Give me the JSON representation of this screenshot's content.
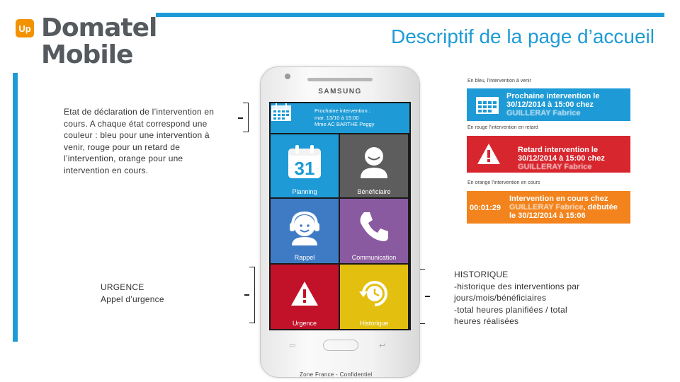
{
  "header": {
    "logo_badge": "Up",
    "logo_line1": "Domatel",
    "logo_line2": "Mobile",
    "title": "Descriptif de la page d’accueil"
  },
  "notes": {
    "status": "Etat de déclaration de l’intervention en cours. A chaque état correspond une couleur : bleu pour une intervention à venir, rouge pour un retard de l’intervention, orange pour une intervention en cours.",
    "urgence_line1": "URGENCE",
    "urgence_line2": "Appel d’urgence",
    "historique_line1": "HISTORIQUE",
    "historique_line2": "-historique des interventions par jours/mois/bénéficiaires",
    "historique_line3": "-total heures planifiées / total heures réalisées"
  },
  "phone": {
    "brand": "SAMSUNG",
    "banner_line1": "Prochaine intervention :",
    "banner_line2": "mar. 13/10 à 15:00",
    "banner_line3": "Mme AC BARTHE Peggy",
    "calendar_day": "31",
    "tiles": {
      "planning": "Planning",
      "beneficiaire": "Bénéficiaire",
      "rappel": "Rappel",
      "communication": "Communication",
      "urgence": "Urgence",
      "historique": "Historique"
    }
  },
  "states": {
    "blue_caption": "En bleu, l’intervention à venir",
    "blue_line1": "Prochaine intervention le",
    "blue_line2": "30/12/2014 à 15:00 chez",
    "blue_line3": "GUILLERAY Fabrice",
    "red_caption": "En rouge l’intervention en retard",
    "red_line1": "Retard intervention le",
    "red_line2": "30/12/2014 à 15:00 chez",
    "red_line3": "GUILLERAY Fabrice",
    "orange_caption": "En orange l’intervention en cours",
    "orange_timer": "00:01:29",
    "orange_line1": "Intervention en cours chez",
    "orange_line2_name": "GUILLERAY Fabrice",
    "orange_line2_suffix": ", débutée",
    "orange_line3": "le 30/12/2014 à 15:06"
  },
  "footer": "Zone France - Confidentiel",
  "colors": {
    "accent_blue": "#1e9bd6",
    "logo_orange": "#f39200",
    "urgent_red": "#c2122a",
    "history_yellow": "#e3c00f",
    "late_red": "#d8262e",
    "ongoing_orange": "#f3831c"
  }
}
